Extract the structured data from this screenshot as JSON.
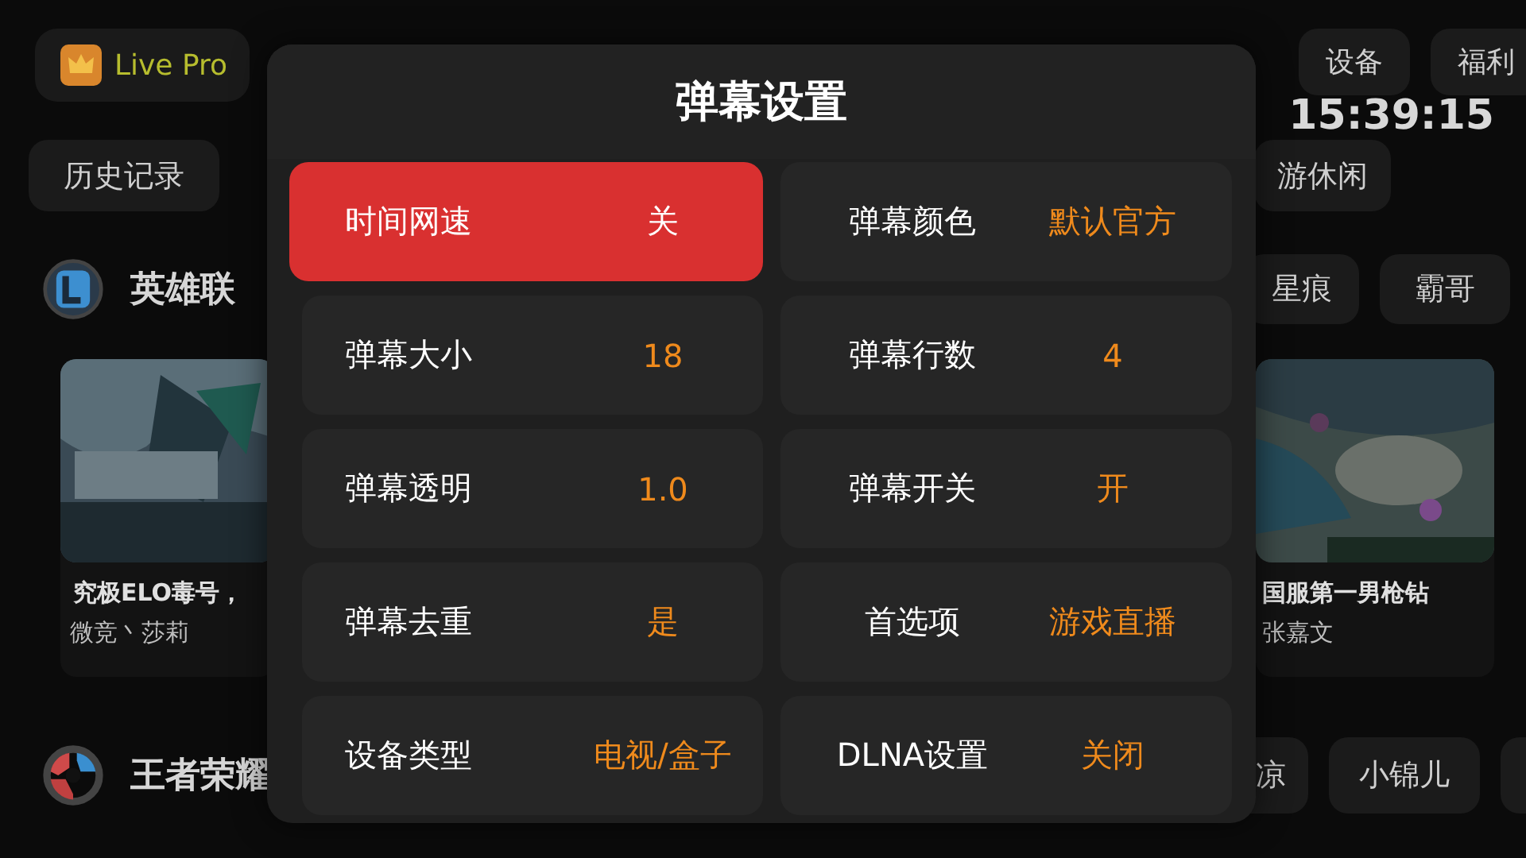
{
  "app": {
    "name": "Live Pro"
  },
  "top_buttons": [
    {
      "label": "设备"
    },
    {
      "label": "福利"
    }
  ],
  "clock": "15:39:15",
  "chips": [
    {
      "label": "历史记录"
    },
    {
      "label": "游休闲"
    }
  ],
  "sections": [
    {
      "kind": "lol",
      "title": "英雄联",
      "tags": [
        "星痕",
        "霸哥"
      ],
      "cards": [
        {
          "title": "究极ELO毒号，",
          "author": "微竞丶莎莉"
        },
        {
          "title": "国服第一男枪钻",
          "author": "张嘉文"
        }
      ]
    },
    {
      "kind": "king",
      "title": "王者荣耀",
      "tags": [
        "凉",
        "小锦儿"
      ]
    }
  ],
  "dialog": {
    "title": "弹幕设置",
    "options": [
      {
        "label": "时间网速",
        "value": "关",
        "selected": true
      },
      {
        "label": "弹幕颜色",
        "value": "默认官方",
        "selected": false
      },
      {
        "label": "弹幕大小",
        "value": "18",
        "selected": false
      },
      {
        "label": "弹幕行数",
        "value": "4",
        "selected": false
      },
      {
        "label": "弹幕透明",
        "value": "1.0",
        "selected": false
      },
      {
        "label": "弹幕开关",
        "value": "开",
        "selected": false
      },
      {
        "label": "弹幕去重",
        "value": "是",
        "selected": false
      },
      {
        "label": "首选项",
        "value": "游戏直播",
        "selected": false
      },
      {
        "label": "设备类型",
        "value": "电视/盒子",
        "selected": false
      },
      {
        "label": "DLNA设置",
        "value": "关闭",
        "selected": false
      }
    ]
  }
}
